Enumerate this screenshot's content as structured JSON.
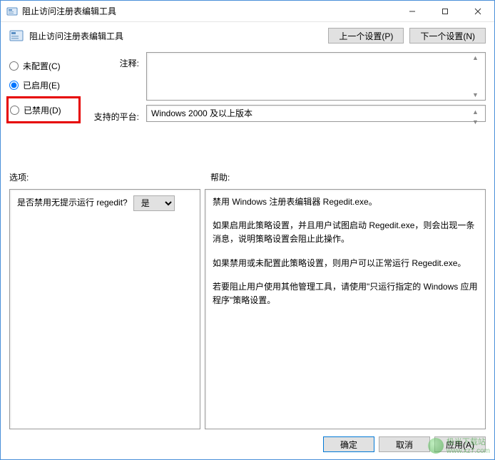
{
  "titlebar": {
    "title": "阻止访问注册表编辑工具"
  },
  "header": {
    "title": "阻止访问注册表编辑工具",
    "prev_btn": "上一个设置(P)",
    "next_btn": "下一个设置(N)"
  },
  "radios": {
    "not_configured": "未配置(C)",
    "enabled": "已启用(E)",
    "disabled": "已禁用(D)"
  },
  "labels": {
    "comment": "注释:",
    "platform": "支持的平台:",
    "options": "选项:",
    "help": "帮助:"
  },
  "fields": {
    "comment_value": "",
    "platform_value": "Windows 2000 及以上版本"
  },
  "options": {
    "question": "是否禁用无提示运行 regedit?",
    "selected": "是"
  },
  "help": {
    "p1": "禁用 Windows 注册表编辑器 Regedit.exe。",
    "p2": "如果启用此策略设置，并且用户试图启动 Regedit.exe，则会出现一条消息，说明策略设置会阻止此操作。",
    "p3": "如果禁用或未配置此策略设置，则用户可以正常运行 Regedit.exe。",
    "p4": "若要阻止用户使用其他管理工具，请使用\"只运行指定的 Windows 应用程序\"策略设置。"
  },
  "footer": {
    "ok": "确定",
    "cancel": "取消",
    "apply": "应用(A)"
  },
  "watermark": {
    "name": "极光下载站",
    "url": "www.xz7.com"
  }
}
